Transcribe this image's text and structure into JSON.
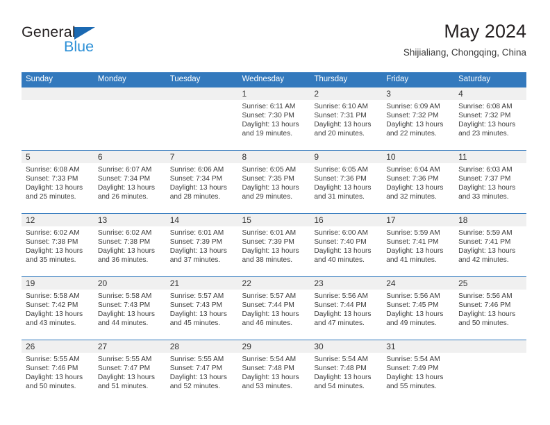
{
  "brand": {
    "name_part1": "General",
    "name_part2": "Blue",
    "triangle_icon": "triangle-icon",
    "accent_blue": "#2b8fd6",
    "logo_dark": "#231f20"
  },
  "header": {
    "title": "May 2024",
    "subtitle": "Shijialiang, Chongqing, China"
  },
  "theme": {
    "header_row_bg": "#3379bd",
    "day_strip_bg": "#f0f0f0",
    "divider": "#3379bd",
    "text": "#3b3b3b"
  },
  "columns": [
    "Sunday",
    "Monday",
    "Tuesday",
    "Wednesday",
    "Thursday",
    "Friday",
    "Saturday"
  ],
  "labels": {
    "sunrise_prefix": "Sunrise:",
    "sunset_prefix": "Sunset:",
    "daylight_prefix": "Daylight:"
  },
  "weeks": [
    [
      {
        "day": "",
        "empty": true
      },
      {
        "day": "",
        "empty": true
      },
      {
        "day": "",
        "empty": true
      },
      {
        "day": "1",
        "sunrise": "Sunrise: 6:11 AM",
        "sunset": "Sunset: 7:30 PM",
        "daylight_l1": "Daylight: 13 hours",
        "daylight_l2": "and 19 minutes."
      },
      {
        "day": "2",
        "sunrise": "Sunrise: 6:10 AM",
        "sunset": "Sunset: 7:31 PM",
        "daylight_l1": "Daylight: 13 hours",
        "daylight_l2": "and 20 minutes."
      },
      {
        "day": "3",
        "sunrise": "Sunrise: 6:09 AM",
        "sunset": "Sunset: 7:32 PM",
        "daylight_l1": "Daylight: 13 hours",
        "daylight_l2": "and 22 minutes."
      },
      {
        "day": "4",
        "sunrise": "Sunrise: 6:08 AM",
        "sunset": "Sunset: 7:32 PM",
        "daylight_l1": "Daylight: 13 hours",
        "daylight_l2": "and 23 minutes."
      }
    ],
    [
      {
        "day": "5",
        "sunrise": "Sunrise: 6:08 AM",
        "sunset": "Sunset: 7:33 PM",
        "daylight_l1": "Daylight: 13 hours",
        "daylight_l2": "and 25 minutes."
      },
      {
        "day": "6",
        "sunrise": "Sunrise: 6:07 AM",
        "sunset": "Sunset: 7:34 PM",
        "daylight_l1": "Daylight: 13 hours",
        "daylight_l2": "and 26 minutes."
      },
      {
        "day": "7",
        "sunrise": "Sunrise: 6:06 AM",
        "sunset": "Sunset: 7:34 PM",
        "daylight_l1": "Daylight: 13 hours",
        "daylight_l2": "and 28 minutes."
      },
      {
        "day": "8",
        "sunrise": "Sunrise: 6:05 AM",
        "sunset": "Sunset: 7:35 PM",
        "daylight_l1": "Daylight: 13 hours",
        "daylight_l2": "and 29 minutes."
      },
      {
        "day": "9",
        "sunrise": "Sunrise: 6:05 AM",
        "sunset": "Sunset: 7:36 PM",
        "daylight_l1": "Daylight: 13 hours",
        "daylight_l2": "and 31 minutes."
      },
      {
        "day": "10",
        "sunrise": "Sunrise: 6:04 AM",
        "sunset": "Sunset: 7:36 PM",
        "daylight_l1": "Daylight: 13 hours",
        "daylight_l2": "and 32 minutes."
      },
      {
        "day": "11",
        "sunrise": "Sunrise: 6:03 AM",
        "sunset": "Sunset: 7:37 PM",
        "daylight_l1": "Daylight: 13 hours",
        "daylight_l2": "and 33 minutes."
      }
    ],
    [
      {
        "day": "12",
        "sunrise": "Sunrise: 6:02 AM",
        "sunset": "Sunset: 7:38 PM",
        "daylight_l1": "Daylight: 13 hours",
        "daylight_l2": "and 35 minutes."
      },
      {
        "day": "13",
        "sunrise": "Sunrise: 6:02 AM",
        "sunset": "Sunset: 7:38 PM",
        "daylight_l1": "Daylight: 13 hours",
        "daylight_l2": "and 36 minutes."
      },
      {
        "day": "14",
        "sunrise": "Sunrise: 6:01 AM",
        "sunset": "Sunset: 7:39 PM",
        "daylight_l1": "Daylight: 13 hours",
        "daylight_l2": "and 37 minutes."
      },
      {
        "day": "15",
        "sunrise": "Sunrise: 6:01 AM",
        "sunset": "Sunset: 7:39 PM",
        "daylight_l1": "Daylight: 13 hours",
        "daylight_l2": "and 38 minutes."
      },
      {
        "day": "16",
        "sunrise": "Sunrise: 6:00 AM",
        "sunset": "Sunset: 7:40 PM",
        "daylight_l1": "Daylight: 13 hours",
        "daylight_l2": "and 40 minutes."
      },
      {
        "day": "17",
        "sunrise": "Sunrise: 5:59 AM",
        "sunset": "Sunset: 7:41 PM",
        "daylight_l1": "Daylight: 13 hours",
        "daylight_l2": "and 41 minutes."
      },
      {
        "day": "18",
        "sunrise": "Sunrise: 5:59 AM",
        "sunset": "Sunset: 7:41 PM",
        "daylight_l1": "Daylight: 13 hours",
        "daylight_l2": "and 42 minutes."
      }
    ],
    [
      {
        "day": "19",
        "sunrise": "Sunrise: 5:58 AM",
        "sunset": "Sunset: 7:42 PM",
        "daylight_l1": "Daylight: 13 hours",
        "daylight_l2": "and 43 minutes."
      },
      {
        "day": "20",
        "sunrise": "Sunrise: 5:58 AM",
        "sunset": "Sunset: 7:43 PM",
        "daylight_l1": "Daylight: 13 hours",
        "daylight_l2": "and 44 minutes."
      },
      {
        "day": "21",
        "sunrise": "Sunrise: 5:57 AM",
        "sunset": "Sunset: 7:43 PM",
        "daylight_l1": "Daylight: 13 hours",
        "daylight_l2": "and 45 minutes."
      },
      {
        "day": "22",
        "sunrise": "Sunrise: 5:57 AM",
        "sunset": "Sunset: 7:44 PM",
        "daylight_l1": "Daylight: 13 hours",
        "daylight_l2": "and 46 minutes."
      },
      {
        "day": "23",
        "sunrise": "Sunrise: 5:56 AM",
        "sunset": "Sunset: 7:44 PM",
        "daylight_l1": "Daylight: 13 hours",
        "daylight_l2": "and 47 minutes."
      },
      {
        "day": "24",
        "sunrise": "Sunrise: 5:56 AM",
        "sunset": "Sunset: 7:45 PM",
        "daylight_l1": "Daylight: 13 hours",
        "daylight_l2": "and 49 minutes."
      },
      {
        "day": "25",
        "sunrise": "Sunrise: 5:56 AM",
        "sunset": "Sunset: 7:46 PM",
        "daylight_l1": "Daylight: 13 hours",
        "daylight_l2": "and 50 minutes."
      }
    ],
    [
      {
        "day": "26",
        "sunrise": "Sunrise: 5:55 AM",
        "sunset": "Sunset: 7:46 PM",
        "daylight_l1": "Daylight: 13 hours",
        "daylight_l2": "and 50 minutes."
      },
      {
        "day": "27",
        "sunrise": "Sunrise: 5:55 AM",
        "sunset": "Sunset: 7:47 PM",
        "daylight_l1": "Daylight: 13 hours",
        "daylight_l2": "and 51 minutes."
      },
      {
        "day": "28",
        "sunrise": "Sunrise: 5:55 AM",
        "sunset": "Sunset: 7:47 PM",
        "daylight_l1": "Daylight: 13 hours",
        "daylight_l2": "and 52 minutes."
      },
      {
        "day": "29",
        "sunrise": "Sunrise: 5:54 AM",
        "sunset": "Sunset: 7:48 PM",
        "daylight_l1": "Daylight: 13 hours",
        "daylight_l2": "and 53 minutes."
      },
      {
        "day": "30",
        "sunrise": "Sunrise: 5:54 AM",
        "sunset": "Sunset: 7:48 PM",
        "daylight_l1": "Daylight: 13 hours",
        "daylight_l2": "and 54 minutes."
      },
      {
        "day": "31",
        "sunrise": "Sunrise: 5:54 AM",
        "sunset": "Sunset: 7:49 PM",
        "daylight_l1": "Daylight: 13 hours",
        "daylight_l2": "and 55 minutes."
      },
      {
        "day": "",
        "empty": true
      }
    ]
  ]
}
